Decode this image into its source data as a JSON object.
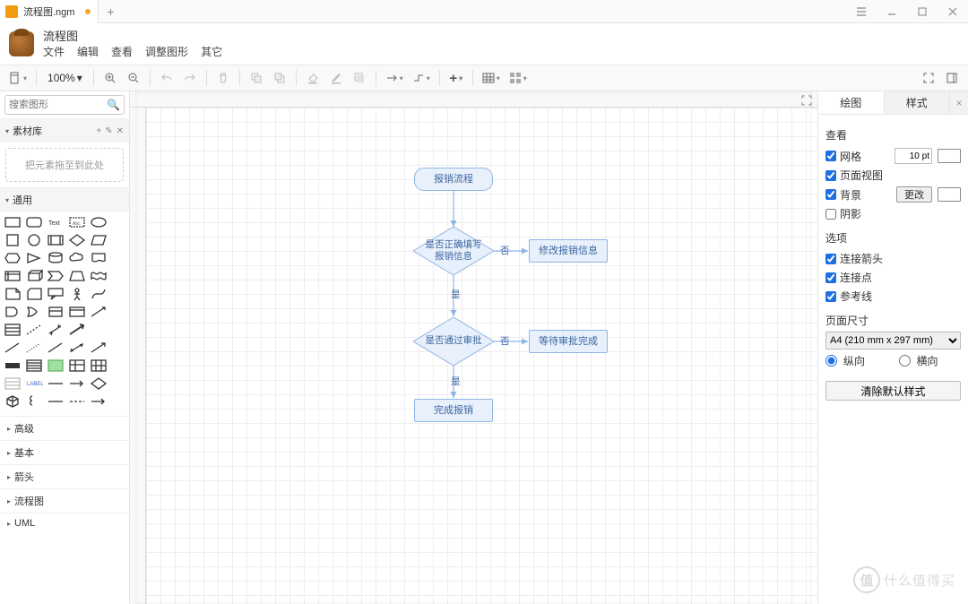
{
  "tab": {
    "filename": "流程图.ngm",
    "unsaved": true
  },
  "window": {
    "docTitle": "流程图"
  },
  "menu": [
    "文件",
    "编辑",
    "查看",
    "调整图形",
    "其它"
  ],
  "toolbar": {
    "zoom": "100%"
  },
  "sidebarLeft": {
    "searchPlaceholder": "搜索图形",
    "materialsLabel": "素材库",
    "dropHint": "把元素拖至到此处",
    "generalLabel": "通用",
    "categories": [
      "高级",
      "基本",
      "箭头",
      "流程图",
      "UML"
    ]
  },
  "flowchart": {
    "nodes": {
      "start": "报销流程",
      "decision1": "是否正确填写\n报销信息",
      "modify": "修改报销信息",
      "decision2": "是否通过审批",
      "wait": "等待审批完成",
      "done": "完成报销"
    },
    "edgeLabels": {
      "no1": "否",
      "yes1": "是",
      "no2": "否",
      "yes2": "是"
    }
  },
  "rightPanel": {
    "tabs": {
      "draw": "绘图",
      "style": "样式"
    },
    "sections": {
      "view": "查看",
      "grid": "网格",
      "gridSize": "10 pt",
      "pageView": "页面视图",
      "background": "背景",
      "changeBtn": "更改",
      "shadow": "阴影",
      "options": "选项",
      "connArrows": "连接箭头",
      "connPoints": "连接点",
      "guides": "参考线",
      "pageSize": "页面尺寸",
      "pageSizeValue": "A4 (210 mm x 297 mm)",
      "portrait": "纵向",
      "landscape": "横向",
      "clearStyle": "清除默认样式"
    }
  },
  "watermark": {
    "char": "值",
    "text": "什么值得买"
  }
}
